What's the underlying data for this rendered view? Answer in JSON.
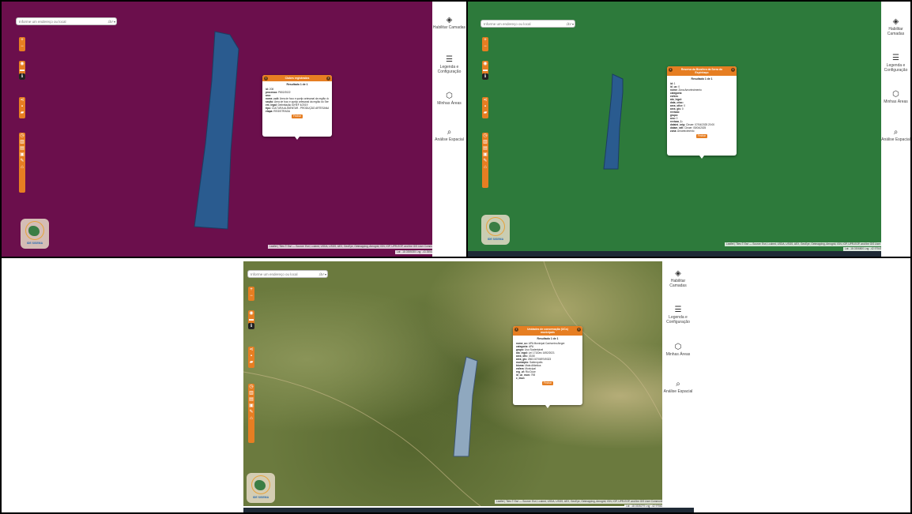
{
  "search": {
    "placeholder": "Informe um endereço ou local"
  },
  "search_logo": "ℰℓ𝓉",
  "toolbar": {
    "zoom_in": "+",
    "zoom_out": "−"
  },
  "sidebar": {
    "layers": "Habilitar Camadas",
    "legend": "Legenda e Configuração",
    "areas": "Minhas Áreas",
    "analysis": "Análise Espacial"
  },
  "popup_a": {
    "title": "Clubes registrados",
    "result": "Resultado 1 de 1",
    "rows": [
      {
        "k": "id:",
        "v": "208"
      },
      {
        "k": "processo:",
        "v": "P802/2022"
      },
      {
        "k": "ano:",
        "v": ""
      },
      {
        "k": "nome_cult:",
        "v": "Área de foco e queijo artesanal da região do Serro"
      },
      {
        "k": "seção:",
        "v": "Área de foco e queijo artesanal da região do Serro"
      },
      {
        "k": "em_legal:",
        "v": "Delimitação IDHEF 4/2019"
      },
      {
        "k": "tipo:",
        "v": "CULTURA ALIMENTAR - PRODUÇÃO ARTESANAL"
      },
      {
        "k": "etapa:",
        "v": "REGISTRADA"
      }
    ],
    "button": "Fechar",
    "prev": "‹",
    "next": "›"
  },
  "popup_b": {
    "title": "Reserva da Biosfera da Serra do Espinhaço",
    "result": "Resultado 1 de 1",
    "rows": [
      {
        "k": "id:",
        "v": "1"
      },
      {
        "k": "id_uc:",
        "v": "0"
      },
      {
        "k": "nome:",
        "v": "Zona Amortecimento"
      },
      {
        "k": "categoria:",
        "v": ""
      },
      {
        "k": "esfera:",
        "v": ""
      },
      {
        "k": "ato_legal:",
        "v": ""
      },
      {
        "k": "data_criac:",
        "v": ""
      },
      {
        "k": "area_oficr:",
        "v": "0"
      },
      {
        "k": "area_gis:",
        "v": "0"
      },
      {
        "k": "revisao:",
        "v": ""
      },
      {
        "k": "grupo:",
        "v": ""
      },
      {
        "k": "ano:",
        "v": "0"
      },
      {
        "k": "revisao_1:",
        "v": ""
      },
      {
        "k": "dataini_orig:",
        "v": "Cleuer: 07/04/2025 20:00"
      },
      {
        "k": "datam_rafi:",
        "v": "Cleuer: 05/04/2025"
      },
      {
        "k": "zona:",
        "v": "Amortecimento"
      }
    ],
    "button": "Fechar",
    "prev": "‹",
    "next": "›"
  },
  "popup_c": {
    "title": "Unidades de conservação (UCs) municipais",
    "result": "Resultado 1 de 1",
    "rows": [
      {
        "k": "nome_uc:",
        "v": "APA Municipal Cachoeira Alegre"
      },
      {
        "k": "categoria:",
        "v": "APA"
      },
      {
        "k": "grupo:",
        "v": "Uso Sustentável"
      },
      {
        "k": "ato_legal:",
        "v": "Lei 171/Dec 1692/2021"
      },
      {
        "k": "area_ofic:",
        "v": "33.50"
      },
      {
        "k": "area_gis:",
        "v": "2563.027089749323"
      },
      {
        "k": "municipio:",
        "v": "Sabinópolis"
      },
      {
        "k": "bioma:",
        "v": "Mata Atlântica"
      },
      {
        "k": "esfera:",
        "v": "Municipal"
      },
      {
        "k": "reg_uf:",
        "v": "Rio Doce"
      },
      {
        "k": "id_uc_mun:",
        "v": "798"
      },
      {
        "k": "c_mun:",
        "v": ""
      }
    ],
    "button": "Fechar",
    "prev": "‹",
    "next": "›"
  },
  "logo_text": "IDE SISEMA",
  "attribution": "Leaflet | Tiles © Esri — Source: Esri, i-cubed, USDA, USGS, AEX, GeoEye, Getmapping, Aerogrid, IGN, IGP, UPR-EGP, and the GIS User Community",
  "coords_a": "Lat: -18.0355035 Lng: -43.3554270",
  "coords_b": "Lat: -18.0306800 Lng: -42.9754321",
  "coords_c": "Lat: -18.0335279 Lng: -42.9756221",
  "colors": {
    "map_a_bg": "#6b0f4c",
    "map_b_bg": "#2d7a3b",
    "polygon_blue": "#2a5b8f",
    "polygon_light": "#8fa8bf",
    "accent": "#e67e22"
  }
}
